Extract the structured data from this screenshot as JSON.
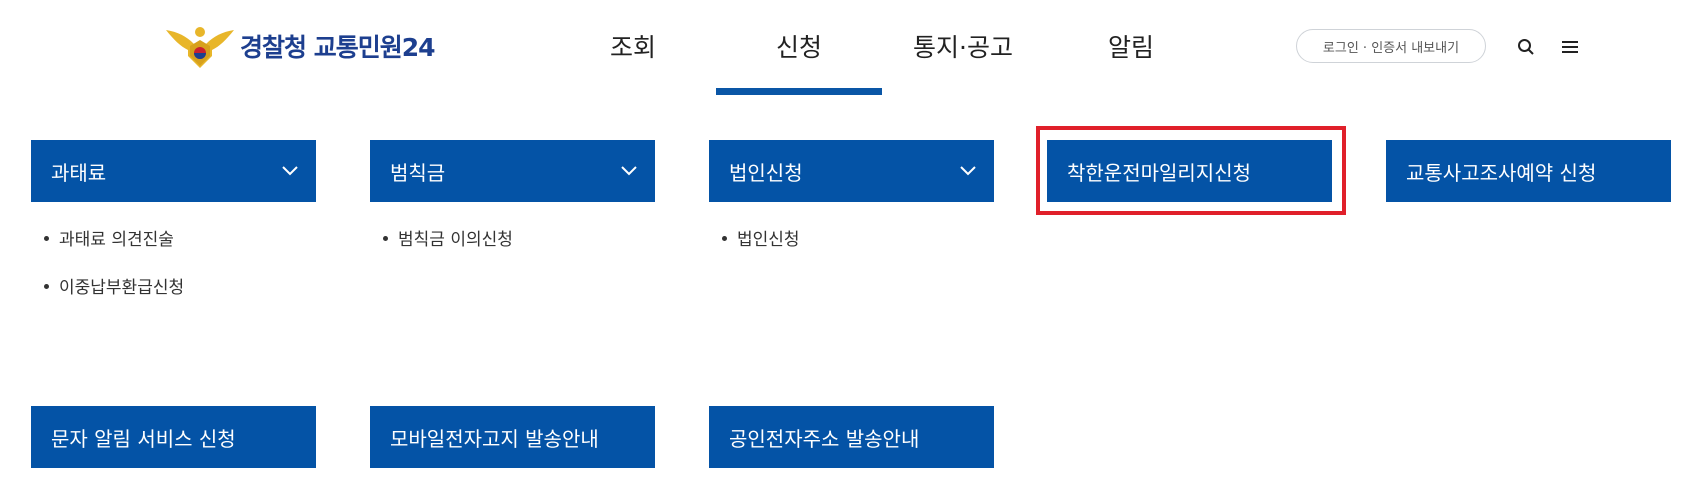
{
  "header": {
    "logo_text": "경찰청 교통민원24",
    "nav": [
      "조회",
      "신청",
      "통지·공고",
      "알림"
    ],
    "active_nav": "신청",
    "login_label": "로그인 · 인증서 내보내기",
    "icons": [
      "search-icon",
      "menu-icon"
    ]
  },
  "menu": {
    "row1": [
      {
        "label": "과태료",
        "has_dropdown": true,
        "sub": [
          "과태료 의견진술",
          "이중납부환급신청"
        ]
      },
      {
        "label": "범칙금",
        "has_dropdown": true,
        "sub": [
          "범칙금 이의신청"
        ]
      },
      {
        "label": "법인신청",
        "has_dropdown": true,
        "sub": [
          "법인신청"
        ]
      },
      {
        "label": "착한운전마일리지신청",
        "has_dropdown": false,
        "highlighted": true
      },
      {
        "label": "교통사고조사예약 신청",
        "has_dropdown": false
      }
    ],
    "row2": [
      {
        "label": "문자 알림 서비스 신청"
      },
      {
        "label": "모바일전자고지 발송안내"
      },
      {
        "label": "공인전자주소 발송안내"
      }
    ]
  },
  "colors": {
    "accent": "#0453a6",
    "highlight": "#e0202a",
    "brand_text": "#1d3f8f"
  }
}
